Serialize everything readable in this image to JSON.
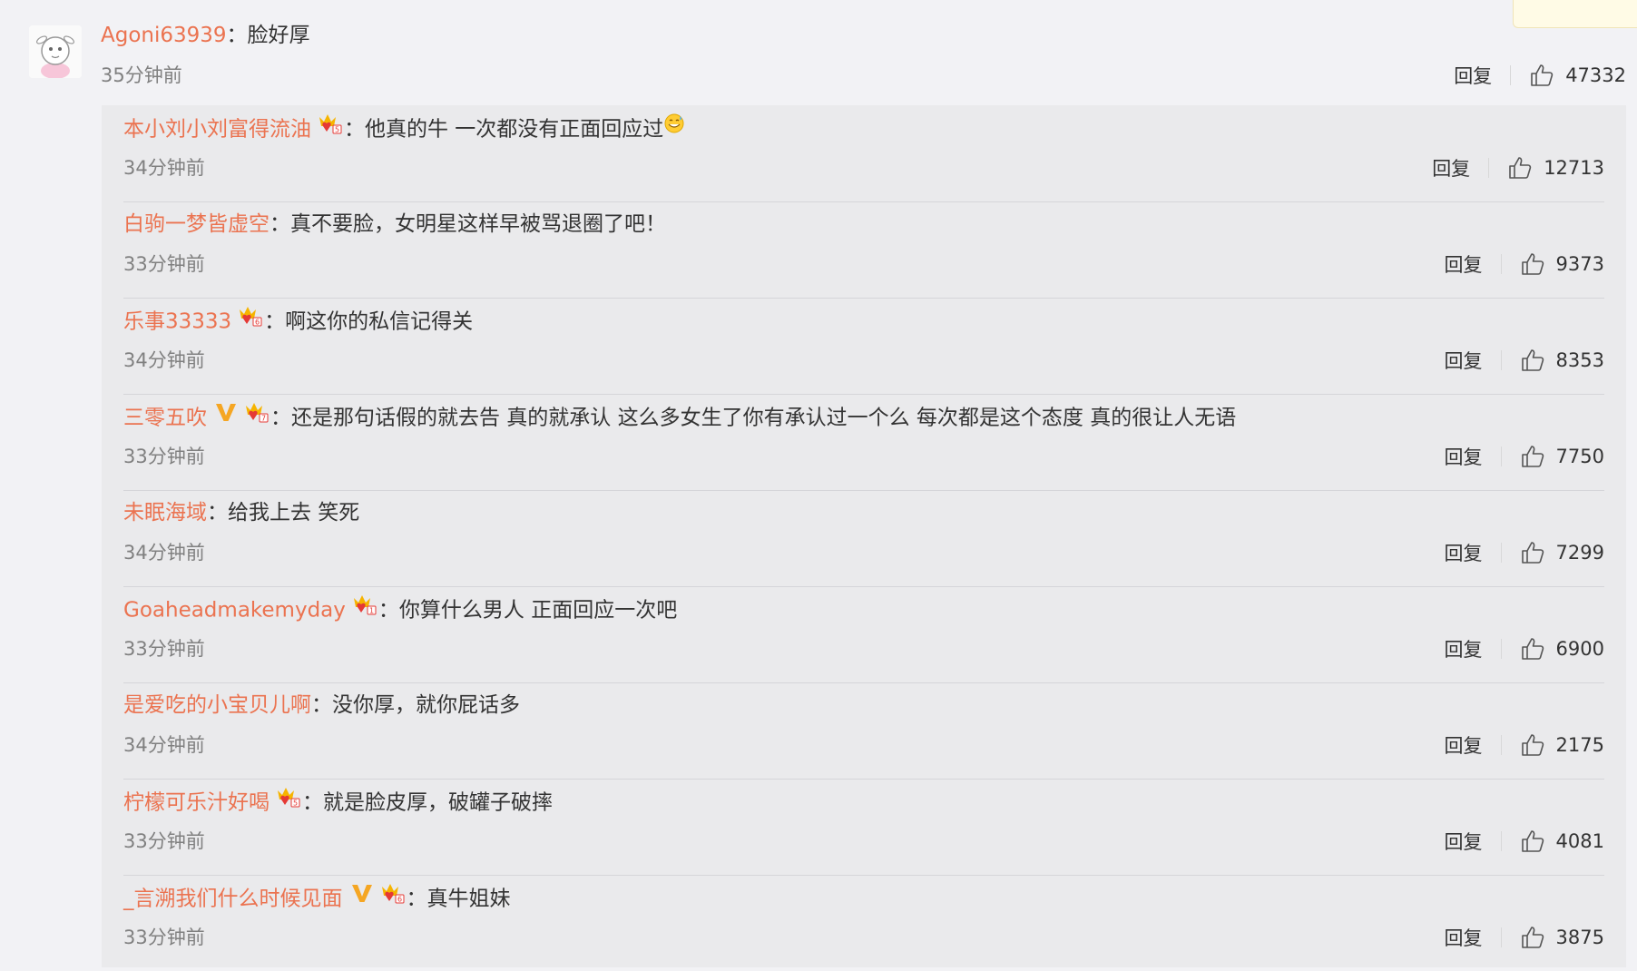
{
  "main_comment": {
    "username": "Agoni63939",
    "separator": "：",
    "text": "脸好厚",
    "time": "35分钟前",
    "reply_label": "回复",
    "likes": "47332"
  },
  "replies": [
    {
      "username": "本小刘小刘富得流油",
      "badges": [
        "crown"
      ],
      "separator": "：",
      "text": "他真的牛 一次都没有正面回应过",
      "emoji": "sweat-smile",
      "time": "34分钟前",
      "reply_label": "回复",
      "likes": "12713"
    },
    {
      "username": "白驹一梦皆虚空",
      "badges": [],
      "separator": "：",
      "text": "真不要脸，女明星这样早被骂退圈了吧！",
      "time": "33分钟前",
      "reply_label": "回复",
      "likes": "9373"
    },
    {
      "username": "乐事33333",
      "badges": [
        "crown"
      ],
      "separator": "：",
      "text": "啊这你的私信记得关",
      "time": "34分钟前",
      "reply_label": "回复",
      "likes": "8353"
    },
    {
      "username": "三零五吹",
      "badges": [
        "v",
        "crown"
      ],
      "separator": "：",
      "text": "还是那句话假的就去告 真的就承认 这么多女生了你有承认过一个么 每次都是这个态度 真的很让人无语",
      "time": "33分钟前",
      "reply_label": "回复",
      "likes": "7750"
    },
    {
      "username": "未眠海域",
      "badges": [],
      "separator": "：",
      "text": "给我上去 笑死",
      "time": "34分钟前",
      "reply_label": "回复",
      "likes": "7299"
    },
    {
      "username": "Goaheadmakemyday",
      "badges": [
        "crown"
      ],
      "separator": "：",
      "text": "你算什么男人 正面回应一次吧",
      "time": "33分钟前",
      "reply_label": "回复",
      "likes": "6900"
    },
    {
      "username": "是爱吃的小宝贝儿啊",
      "badges": [],
      "separator": "：",
      "text": "没你厚，就你屁话多",
      "time": "34分钟前",
      "reply_label": "回复",
      "likes": "2175"
    },
    {
      "username": "柠檬可乐汁好喝",
      "badges": [
        "crown"
      ],
      "separator": "：",
      "text": "就是脸皮厚，破罐子破摔",
      "time": "33分钟前",
      "reply_label": "回复",
      "likes": "4081"
    },
    {
      "username": "_言溯我们什么时候见面",
      "badges": [
        "v",
        "crown"
      ],
      "separator": "：",
      "text": "真牛姐妹",
      "time": "33分钟前",
      "reply_label": "回复",
      "likes": "3875"
    }
  ],
  "colors": {
    "username": "#eb7350",
    "text": "#333333",
    "time": "#808080",
    "v_badge": "#f5a623",
    "crown": "#f6b400"
  },
  "icons": {
    "like": "thumbs-up-outline-icon",
    "verified": "v-badge-icon",
    "member": "crown-heart-icon"
  }
}
